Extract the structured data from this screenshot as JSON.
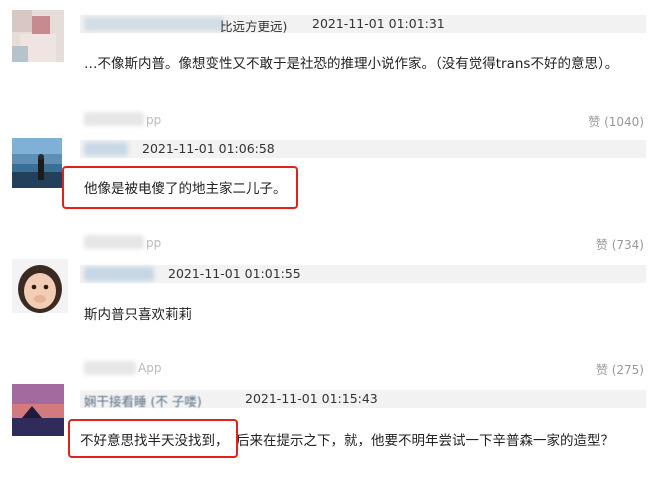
{
  "comments": [
    {
      "name_visible": "比远方更远)",
      "time": "2021-11-01 01:01:31",
      "text": "…不像斯内普。像想变性又不敢于是社恐的推理小说作家。（没有觉得trans不好的意思）。"
    },
    {
      "source": "pp",
      "likes": "赞 (1040)",
      "time": "2021-11-01 01:06:58",
      "text": "他像是被电傻了的地主家二儿子。"
    },
    {
      "source": "pp",
      "likes": "赞 (734)",
      "time": "2021-11-01 01:01:55",
      "text": "斯内普只喜欢莉莉"
    },
    {
      "source": "App",
      "likes": "赞 (275)",
      "name_visible": "娴干接看睡 (不 子喽)",
      "time": "2021-11-01 01:15:43",
      "text_part1": "不好意思找半天没找到，",
      "text_part2": "后来在提示之下，就，他要不明年尝试一下辛普森一家的造型？"
    }
  ],
  "colors": {
    "highlight": "#e3211c",
    "name_bar": "#f2f2f2"
  }
}
